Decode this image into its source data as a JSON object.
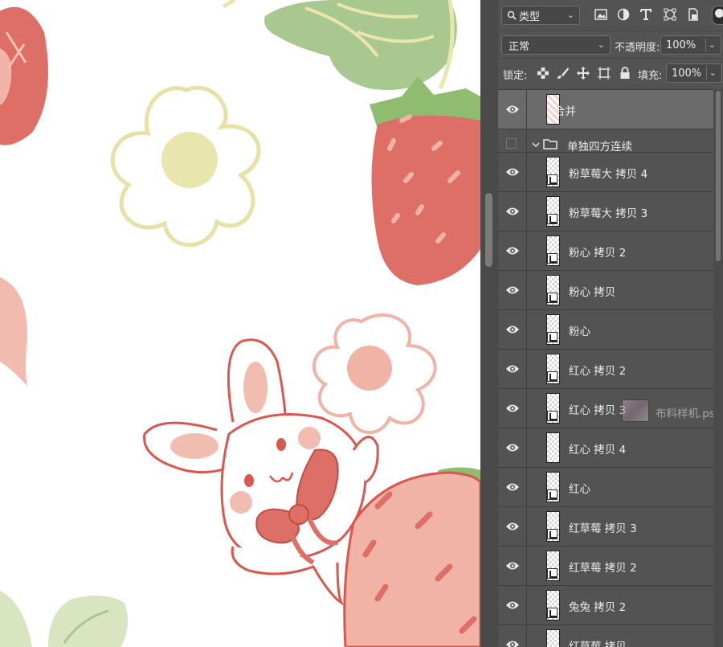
{
  "panel": {
    "filter": {
      "icon": "search-icon",
      "label": "类型"
    },
    "filter_icons": [
      "image-filter-icon",
      "adjustment-filter-icon",
      "type-filter-icon",
      "shape-filter-icon",
      "smart-object-filter-icon"
    ],
    "blend_mode": "正常",
    "opacity_label": "不透明度:",
    "opacity_value": "100%",
    "lock_label": "锁定:",
    "lock_icons": [
      "lock-transparent-icon",
      "lock-paint-icon",
      "lock-position-icon",
      "lock-artboard-icon",
      "lock-all-icon"
    ],
    "fill_label": "填充:",
    "fill_value": "100%"
  },
  "layers": [
    {
      "name": "合并",
      "type": "layer",
      "visible": true,
      "selected": true,
      "smart": false
    },
    {
      "name": "单独四方连续",
      "type": "group",
      "visible": false,
      "expanded": true
    },
    {
      "name": "粉草莓大 拷贝 4",
      "type": "layer",
      "visible": true,
      "smart": true
    },
    {
      "name": "粉草莓大 拷贝 3",
      "type": "layer",
      "visible": true,
      "smart": true
    },
    {
      "name": "粉心 拷贝 2",
      "type": "layer",
      "visible": true,
      "smart": true
    },
    {
      "name": "粉心 拷贝",
      "type": "layer",
      "visible": true,
      "smart": true
    },
    {
      "name": "粉心",
      "type": "layer",
      "visible": true,
      "smart": true
    },
    {
      "name": "红心 拷贝 2",
      "type": "layer",
      "visible": true,
      "smart": true
    },
    {
      "name": "红心 拷贝 3",
      "type": "layer",
      "visible": true,
      "smart": true
    },
    {
      "name": "红心 拷贝 4",
      "type": "layer",
      "visible": true,
      "smart": false
    },
    {
      "name": "红心",
      "type": "layer",
      "visible": true,
      "smart": true
    },
    {
      "name": "红草莓 拷贝 3",
      "type": "layer",
      "visible": true,
      "smart": true
    },
    {
      "name": "红草莓 拷贝 2",
      "type": "layer",
      "visible": true,
      "smart": true
    },
    {
      "name": "兔兔 拷贝 2",
      "type": "layer",
      "visible": true,
      "smart": true
    },
    {
      "name": "红草莓 拷贝",
      "type": "layer",
      "visible": true,
      "smart": true
    }
  ],
  "drag_ghost": {
    "label": "布料样机.psd"
  },
  "colors": {
    "strawberry_red": "#dd6f66",
    "strawberry_pink": "#f1b3a6",
    "leaf_green": "#a9c88f",
    "flower_yellow": "#e9e6ad",
    "bunny_outline": "#d9574f",
    "panel_bg": "#535353",
    "selected_row": "#6b6b6b"
  }
}
